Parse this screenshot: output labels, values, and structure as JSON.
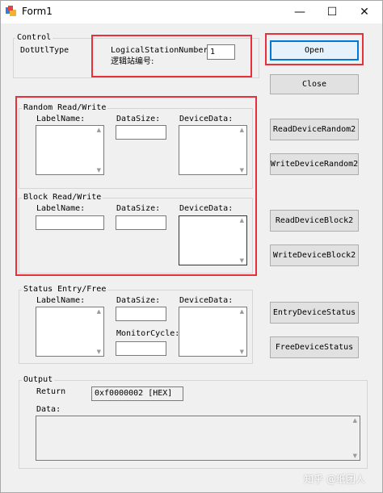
{
  "window": {
    "title": "Form1",
    "minimize_glyph": "—",
    "maximize_glyph": "☐",
    "close_glyph": "✕"
  },
  "control": {
    "group_label": "Control",
    "dotutl_label": "DotUtlType",
    "station_label_en": "LogicalStationNumber:",
    "station_label_cn": "逻辑站编号:",
    "station_value": "1",
    "open_label": "Open",
    "close_label": "Close"
  },
  "random": {
    "group_label": "Random Read/Write",
    "labelname_label": "LabelName:",
    "datasize_label": "DataSize:",
    "devicedata_label": "DeviceData:",
    "read_button": "ReadDeviceRandom2",
    "write_button": "WriteDeviceRandom2"
  },
  "block": {
    "group_label": "Block Read/Write",
    "labelname_label": "LabelName:",
    "datasize_label": "DataSize:",
    "devicedata_label": "DeviceData:",
    "read_button": "ReadDeviceBlock2",
    "write_button": "WriteDeviceBlock2"
  },
  "status": {
    "group_label": "Status Entry/Free",
    "labelname_label": "LabelName:",
    "datasize_label": "DataSize:",
    "devicedata_label": "DeviceData:",
    "monitorcycle_label": "MonitorCycle:",
    "entry_button": "EntryDeviceStatus",
    "free_button": "FreeDeviceStatus"
  },
  "output": {
    "group_label": "Output",
    "return_label": "Return",
    "return_value": "0xf0000002 [HEX]",
    "data_label": "Data:"
  },
  "watermark": "知乎 @纸团人",
  "colors": {
    "highlight": "#e8303a",
    "focus": "#0078d7",
    "face": "#f0f0f0"
  }
}
